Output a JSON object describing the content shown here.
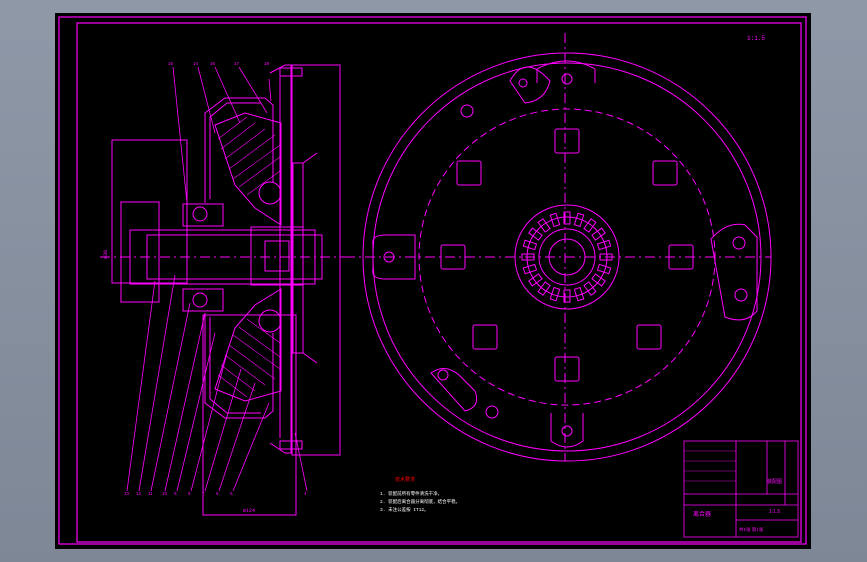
{
  "viewer": {
    "background": "#000000",
    "chrome_color": "#8a94a3"
  },
  "drawing": {
    "line_color": "#ff00ff",
    "text_color": "#ff0000",
    "note_color": "#ffffff",
    "corner_mark": "1:1.5",
    "section_leaders": [
      "13",
      "12",
      "11",
      "10",
      "9",
      "8",
      "7",
      "6",
      "5",
      "4",
      "3",
      "2",
      "1"
    ],
    "top_leaders": [
      "15",
      "14",
      "16",
      "17",
      "18"
    ],
    "dimension_bottom": "ø124",
    "dimension_left": "ø30",
    "tech_notes_heading": "技术要求",
    "tech_notes": [
      "1. 装配前所有零件清洗干净。",
      "2. 装配后离合器分离彻底，结合平稳。",
      "3. 未注公差按 IT12。"
    ]
  },
  "title_block": {
    "title": "离合器",
    "subtitle": "装配图",
    "scale": "1:1.5",
    "sheet": "共1张 第1张"
  }
}
